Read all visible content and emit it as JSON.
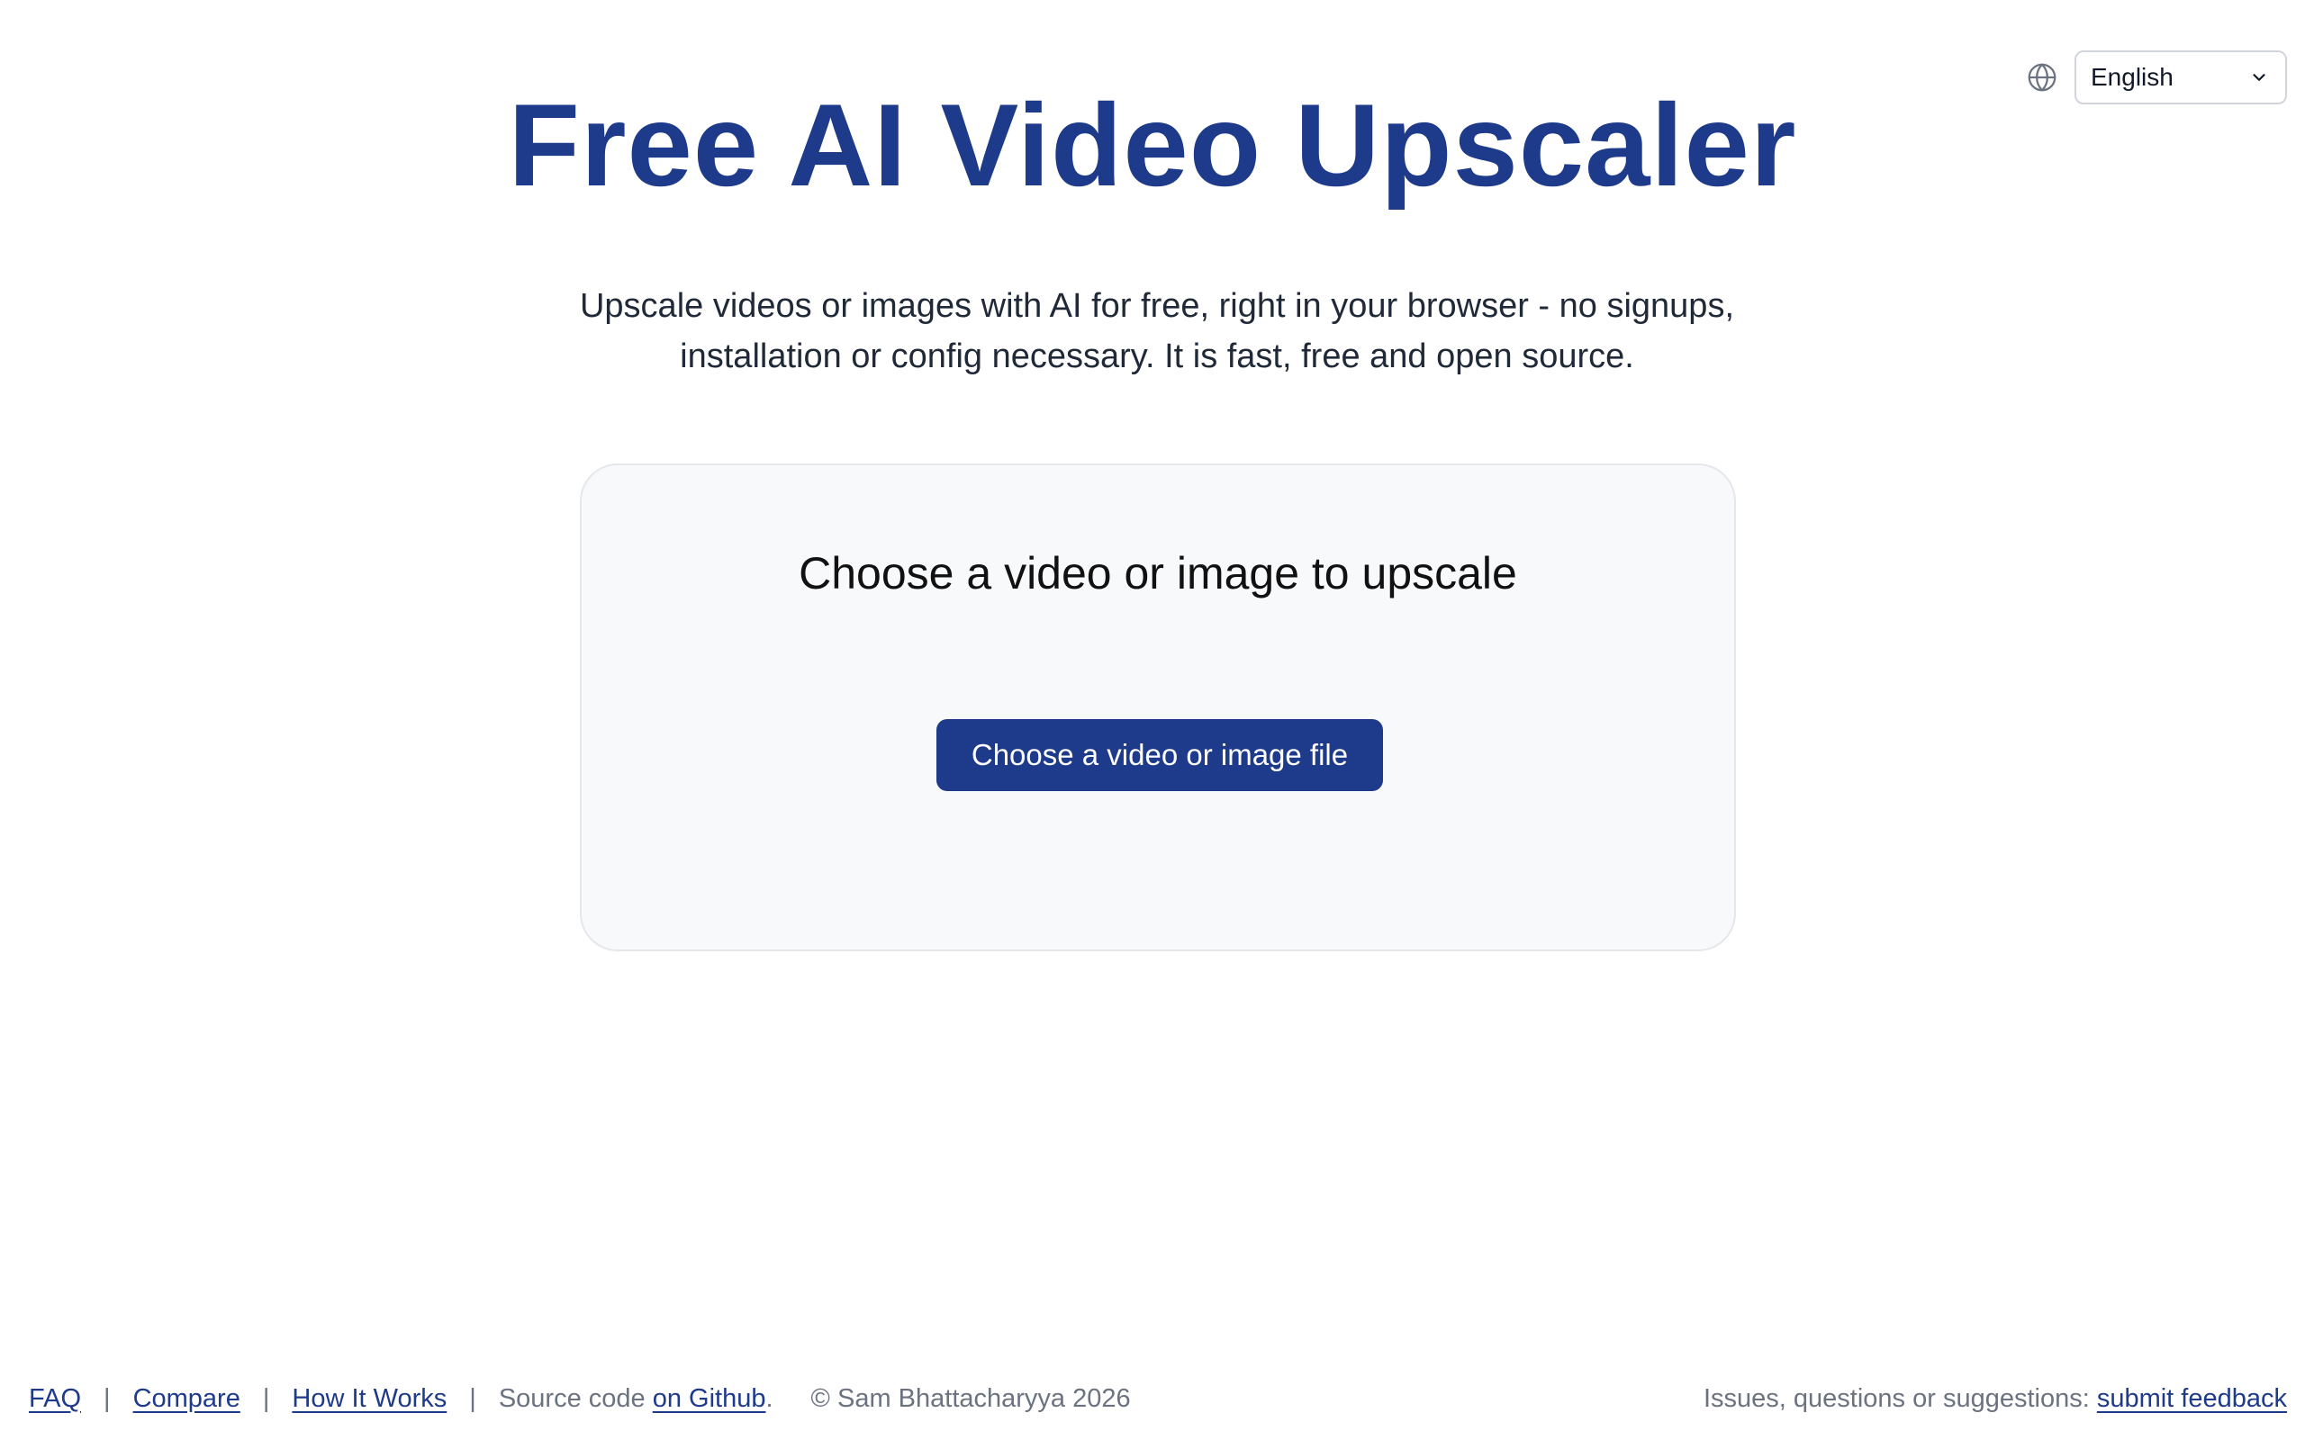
{
  "language": {
    "icon": "globe-icon",
    "selected": "English",
    "chevron_icon": "chevron-down-icon"
  },
  "header": {
    "title": "Free AI Video Upscaler"
  },
  "intro": {
    "text": "Upscale videos or images with AI for free, right in your browser - no signups, installation or config necessary. It is fast, free and open source."
  },
  "upload": {
    "heading": "Choose a video or image to upscale",
    "button_label": "Choose a video or image file"
  },
  "footer": {
    "links": {
      "faq": "FAQ",
      "compare": "Compare",
      "how_it_works": "How It Works"
    },
    "separator": "|",
    "source_prefix": "Source code ",
    "source_link": "on Github",
    "source_suffix": ".",
    "copyright": "© Sam Bhattacharyya 2026",
    "feedback_prefix": "Issues, questions or suggestions: ",
    "feedback_link": "submit feedback"
  },
  "colors": {
    "brand": "#1e3a8a",
    "card_background": "#f8f9fb",
    "muted_text": "#6b7280"
  }
}
